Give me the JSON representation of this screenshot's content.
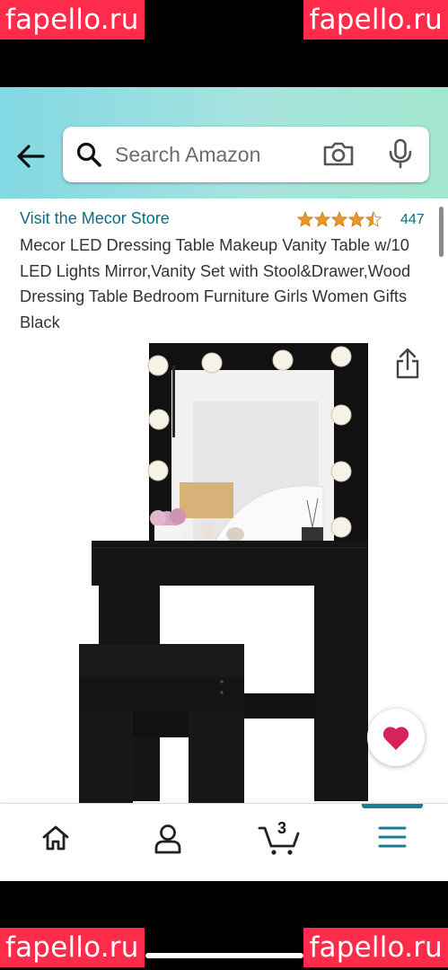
{
  "watermarks": [
    "fapello.ru",
    "fapello.ru",
    "fapello.ru",
    "fapello.ru"
  ],
  "search": {
    "placeholder": "Search Amazon"
  },
  "product": {
    "store_link": "Visit the Mecor Store",
    "rating": 4.5,
    "review_count": "447",
    "title": "Mecor LED Dressing Table Makeup Vanity Table w/10 LED Lights Mirror,Vanity Set with Stool&Drawer,Wood Dressing Table Bedroom Furniture Girls Women Gifts Black"
  },
  "nav": {
    "cart_count": "3",
    "active_tab": "menu"
  },
  "colors": {
    "accent": "#1a7f96",
    "link": "#0f6b84",
    "star": "#e8952c",
    "heart": "#d6245b"
  },
  "icons": [
    "back-arrow-icon",
    "search-icon",
    "camera-icon",
    "microphone-icon",
    "star-icon",
    "share-icon",
    "heart-icon",
    "home-icon",
    "account-icon",
    "cart-icon",
    "menu-icon"
  ]
}
